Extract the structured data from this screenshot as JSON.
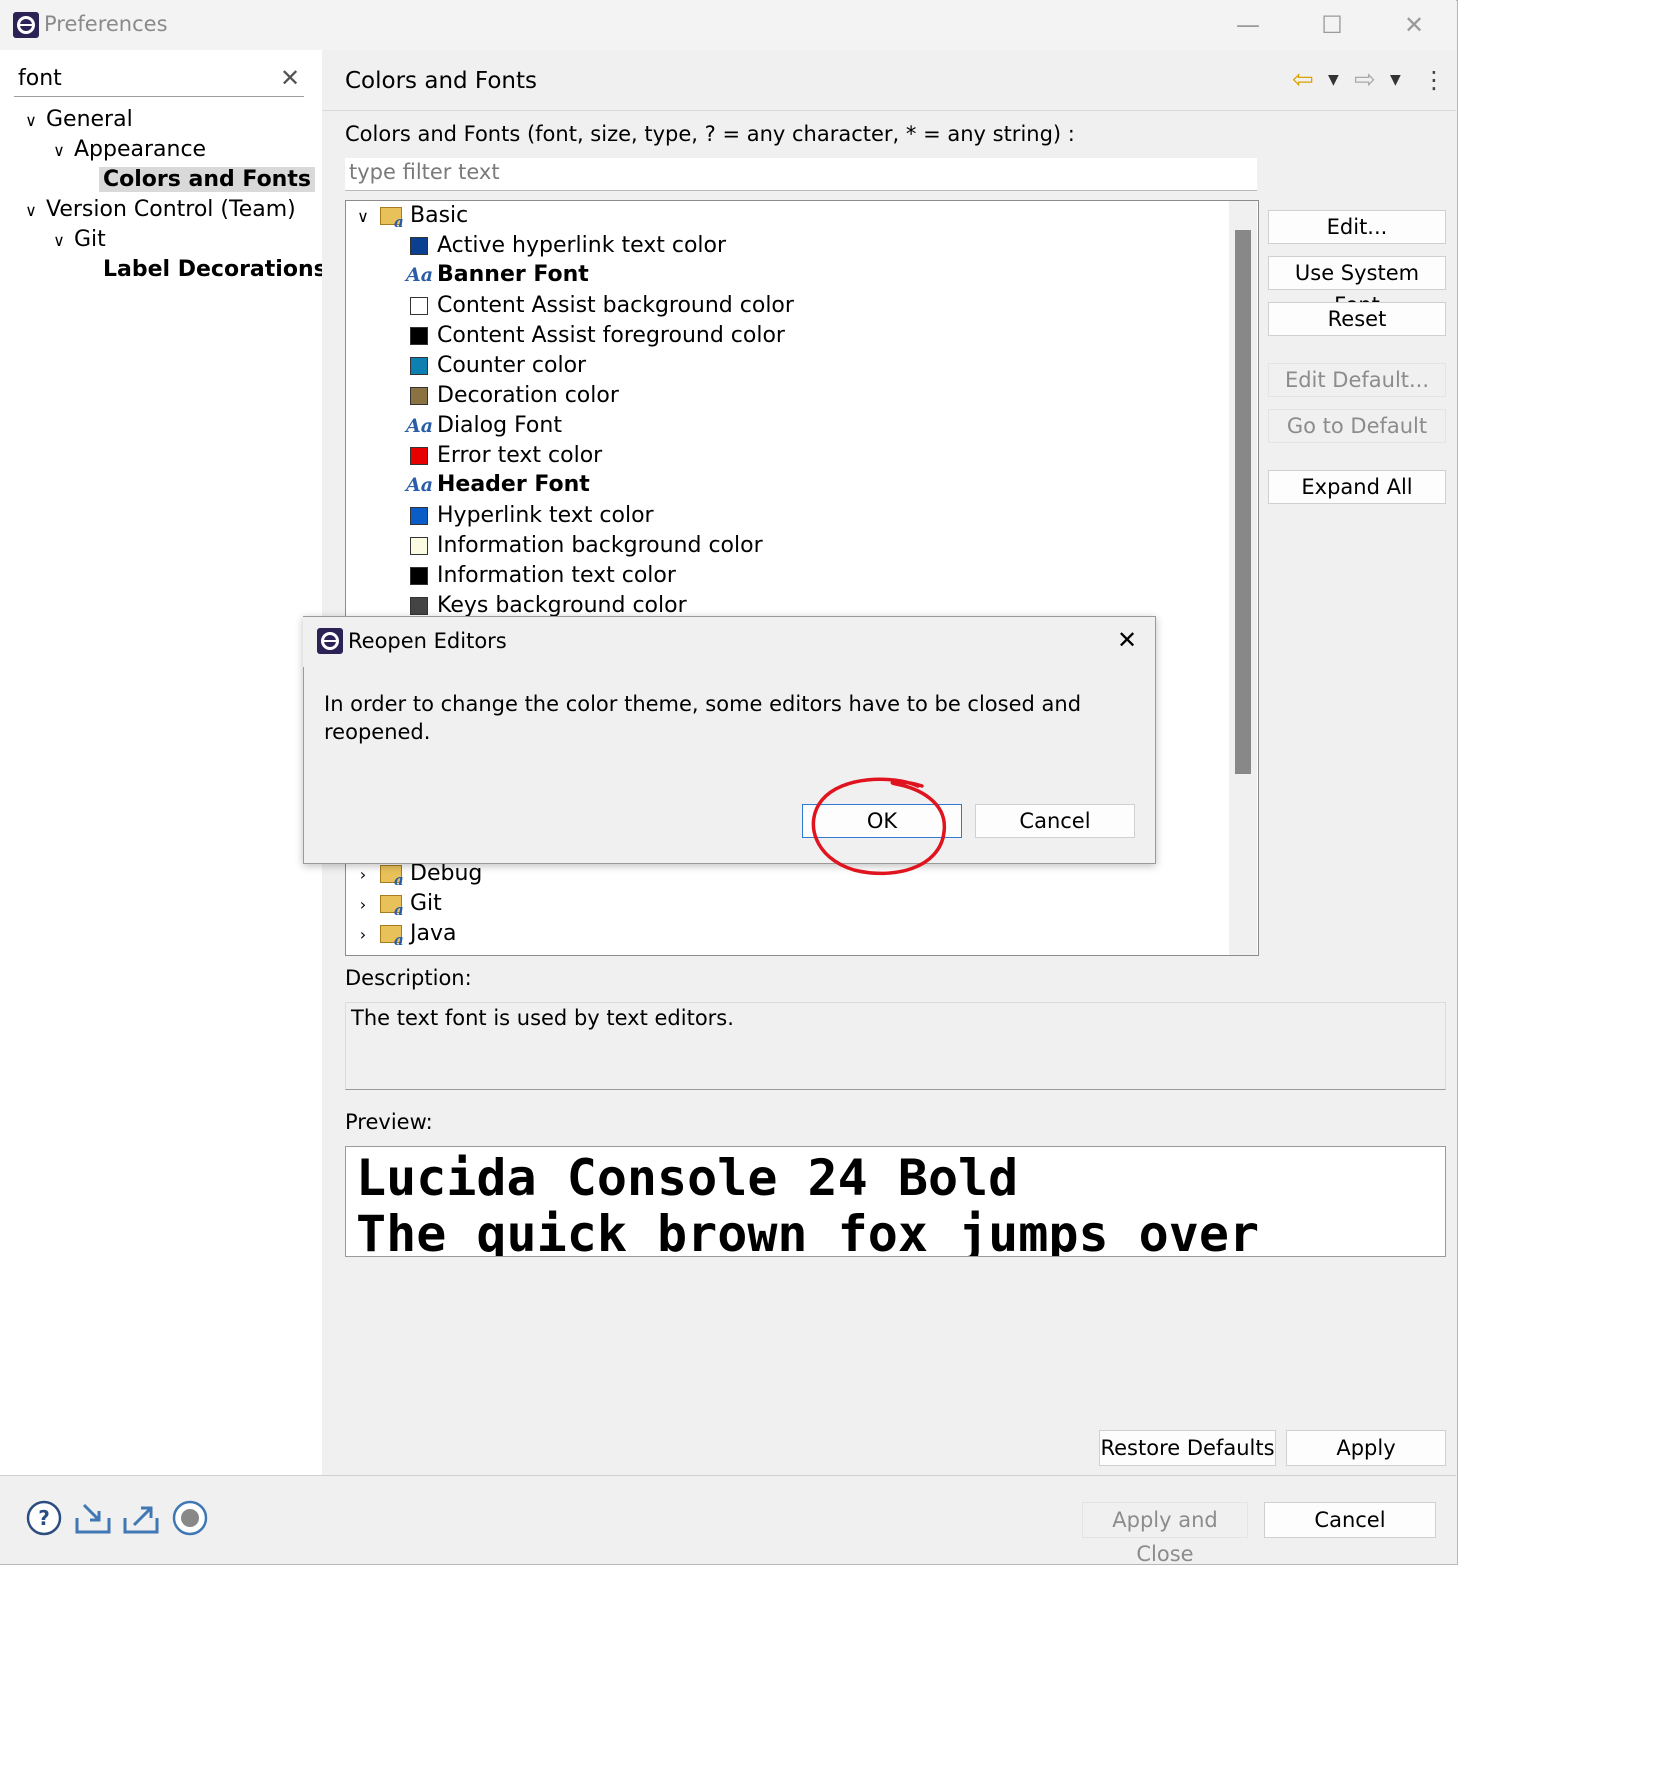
{
  "window": {
    "title": "Preferences",
    "controls": [
      "—",
      "☐",
      "✕"
    ]
  },
  "search": {
    "value": "font",
    "clear_glyph": "✕"
  },
  "nav_tree": [
    {
      "label": "General",
      "expanded": true
    },
    {
      "label": "Appearance",
      "expanded": true
    },
    {
      "label": "Colors and Fonts",
      "selected": true
    },
    {
      "label": "Version Control (Team)",
      "expanded": true
    },
    {
      "label": "Git",
      "expanded": true
    },
    {
      "label": "Label Decorations",
      "bold": true
    }
  ],
  "page": {
    "title": "Colors and Fonts",
    "nav_icons": [
      "back-arrow-icon",
      "dropdown-icon",
      "forward-arrow-icon",
      "dropdown-icon",
      "kebab-menu-icon"
    ],
    "filter_label": "Colors and Fonts (font, size, type, ? = any character, * = any string) :",
    "filter_placeholder": "type filter text"
  },
  "tree": {
    "root": "Basic",
    "items": [
      {
        "label": "Active hyperlink text color",
        "kind": "color",
        "color": "#0b3f8f"
      },
      {
        "label": "Banner Font",
        "kind": "font",
        "bold": true
      },
      {
        "label": "Content Assist background color",
        "kind": "color",
        "color": "#ffffff"
      },
      {
        "label": "Content Assist foreground color",
        "kind": "color",
        "color": "#000000"
      },
      {
        "label": "Counter color",
        "kind": "color",
        "color": "#0d7fb0"
      },
      {
        "label": "Decoration color",
        "kind": "color",
        "color": "#8a7340"
      },
      {
        "label": "Dialog Font",
        "kind": "font",
        "bold": false
      },
      {
        "label": "Error text color",
        "kind": "color",
        "color": "#e60000"
      },
      {
        "label": "Header Font",
        "kind": "font",
        "bold": true
      },
      {
        "label": "Hyperlink text color",
        "kind": "color",
        "color": "#0a5cc7"
      },
      {
        "label": "Information background color",
        "kind": "color",
        "color": "#fbfbe1"
      },
      {
        "label": "Information text color",
        "kind": "color",
        "color": "#000000"
      },
      {
        "label": "Keys background color",
        "kind": "color",
        "color": "#444444"
      }
    ],
    "collapsed_groups": [
      "Debug",
      "Git",
      "Java"
    ],
    "font_icon_text": "Aa",
    "folder_icon_text": "a"
  },
  "side_buttons": [
    {
      "label": "Edit...",
      "enabled": true
    },
    {
      "label": "Use System Font",
      "enabled": true
    },
    {
      "label": "Reset",
      "enabled": true
    },
    {
      "label": "Edit Default...",
      "enabled": false
    },
    {
      "label": "Go to Default",
      "enabled": false
    },
    {
      "label": "Expand All",
      "enabled": true
    }
  ],
  "description": {
    "label": "Description:",
    "text": "The text font is used by text editors."
  },
  "preview": {
    "label": "Preview:",
    "line1": "Lucida Console 24 Bold",
    "line2": "The quick brown fox jumps over"
  },
  "page_buttons": {
    "restore": "Restore Defaults",
    "apply": "Apply"
  },
  "footer": {
    "icons": [
      "help-icon",
      "import-icon",
      "export-icon",
      "record-icon"
    ],
    "apply_close": "Apply and Close",
    "cancel": "Cancel"
  },
  "dialog": {
    "title": "Reopen Editors",
    "close_glyph": "✕",
    "message": "In order to change the color theme, some editors have to be closed and reopened.",
    "ok": "OK",
    "cancel": "Cancel",
    "annotation_color": "#e0141e"
  }
}
